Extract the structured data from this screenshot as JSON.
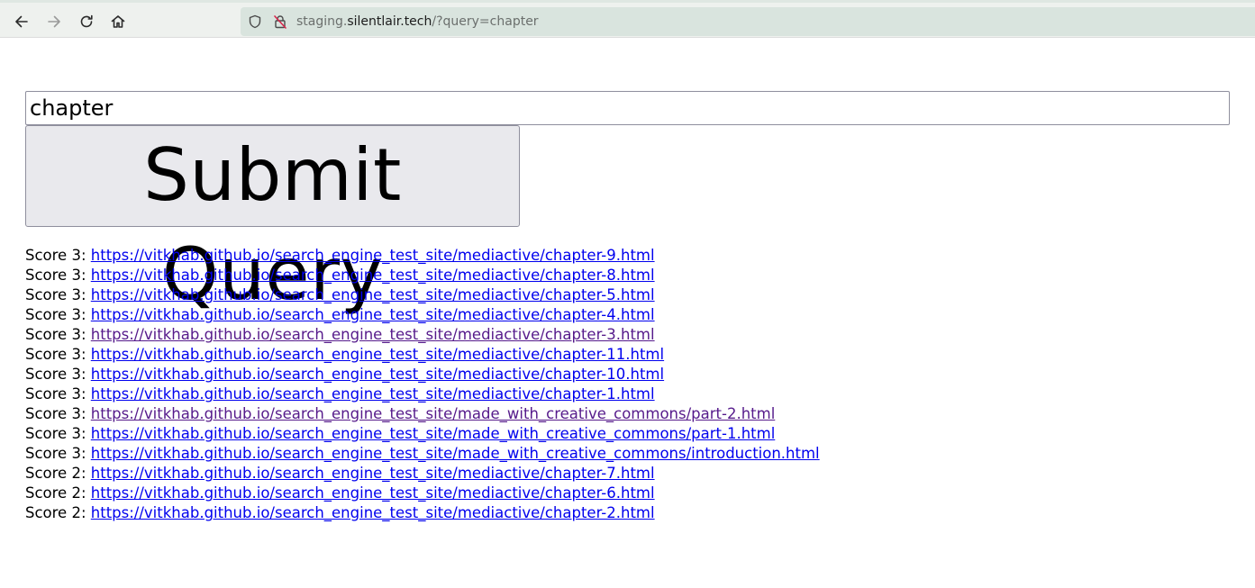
{
  "browser": {
    "url_prefix": "staging.",
    "url_host": "silentlair.tech",
    "url_path": "/?query=chapter",
    "icons": {
      "back": "arrow-left-icon",
      "forward": "arrow-right-icon",
      "reload": "reload-icon",
      "home": "home-icon",
      "shield": "shield-icon",
      "lock": "insecure-lock-icon"
    }
  },
  "search": {
    "query_value": "chapter",
    "submit_label": "Submit Query"
  },
  "results": [
    {
      "score_label": "Score 3:",
      "url": "https://vitkhab.github.io/search_engine_test_site/mediactive/chapter-9.html",
      "visited": false
    },
    {
      "score_label": "Score 3:",
      "url": "https://vitkhab.github.io/search_engine_test_site/mediactive/chapter-8.html",
      "visited": false
    },
    {
      "score_label": "Score 3:",
      "url": "https://vitkhab.github.io/search_engine_test_site/mediactive/chapter-5.html",
      "visited": false
    },
    {
      "score_label": "Score 3:",
      "url": "https://vitkhab.github.io/search_engine_test_site/mediactive/chapter-4.html",
      "visited": false
    },
    {
      "score_label": "Score 3:",
      "url": "https://vitkhab.github.io/search_engine_test_site/mediactive/chapter-3.html",
      "visited": true
    },
    {
      "score_label": "Score 3:",
      "url": "https://vitkhab.github.io/search_engine_test_site/mediactive/chapter-11.html",
      "visited": false
    },
    {
      "score_label": "Score 3:",
      "url": "https://vitkhab.github.io/search_engine_test_site/mediactive/chapter-10.html",
      "visited": false
    },
    {
      "score_label": "Score 3:",
      "url": "https://vitkhab.github.io/search_engine_test_site/mediactive/chapter-1.html",
      "visited": false
    },
    {
      "score_label": "Score 3:",
      "url": "https://vitkhab.github.io/search_engine_test_site/made_with_creative_commons/part-2.html",
      "visited": true
    },
    {
      "score_label": "Score 3:",
      "url": "https://vitkhab.github.io/search_engine_test_site/made_with_creative_commons/part-1.html",
      "visited": false
    },
    {
      "score_label": "Score 3:",
      "url": "https://vitkhab.github.io/search_engine_test_site/made_with_creative_commons/introduction.html",
      "visited": false
    },
    {
      "score_label": "Score 2:",
      "url": "https://vitkhab.github.io/search_engine_test_site/mediactive/chapter-7.html",
      "visited": false
    },
    {
      "score_label": "Score 2:",
      "url": "https://vitkhab.github.io/search_engine_test_site/mediactive/chapter-6.html",
      "visited": false
    },
    {
      "score_label": "Score 2:",
      "url": "https://vitkhab.github.io/search_engine_test_site/mediactive/chapter-2.html",
      "visited": false
    }
  ],
  "colors": {
    "link": "#0000ee",
    "visited_link": "#551a8b",
    "toolbar_bg": "#eef1ee",
    "urlbar_bg": "#d9e4de"
  }
}
